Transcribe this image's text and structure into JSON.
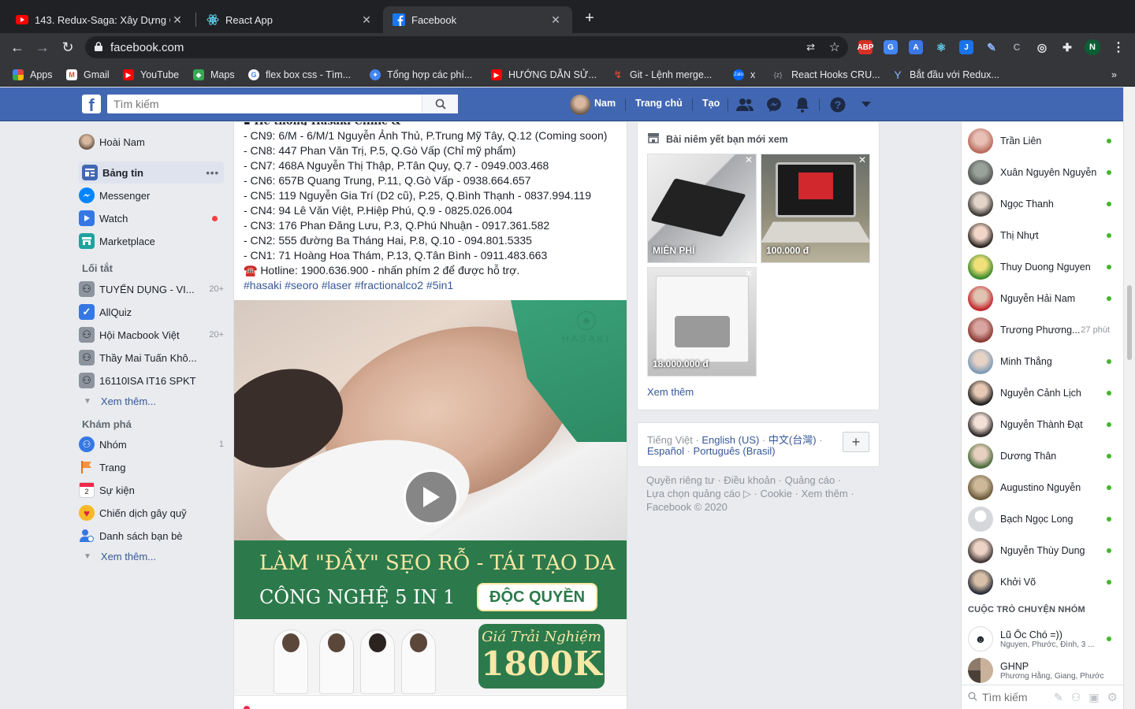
{
  "browser": {
    "tabs": [
      {
        "title": "143. Redux-Saga: Xây Dựng Ch",
        "active": false
      },
      {
        "title": "React App",
        "active": false
      },
      {
        "title": "Facebook",
        "active": true
      }
    ],
    "url": "facebook.com",
    "bookmarks": [
      "Apps",
      "Gmail",
      "YouTube",
      "Maps",
      "flex box css - Tìm...",
      "Tổng hợp các phí...",
      "HƯỚNG DẪN SỬ...",
      "Git - Lệnh merge...",
      "x",
      "React Hooks CRU...",
      "Bắt đầu với Redux..."
    ]
  },
  "topbar": {
    "search_placeholder": "Tìm kiếm",
    "user": "Nam",
    "home": "Trang chủ",
    "create": "Tạo"
  },
  "left": {
    "profile": "Hoài Nam",
    "main": [
      {
        "label": "Bảng tin",
        "icon": "news-feed-icon"
      },
      {
        "label": "Messenger",
        "icon": "messenger-icon"
      },
      {
        "label": "Watch",
        "icon": "watch-icon"
      },
      {
        "label": "Marketplace",
        "icon": "marketplace-icon"
      }
    ],
    "shortcuts_title": "Lối tắt",
    "shortcuts": [
      {
        "label": "TUYỂN DỤNG - VI...",
        "count": "20+"
      },
      {
        "label": "AllQuiz",
        "count": ""
      },
      {
        "label": "Hội Macbook Việt",
        "count": "20+"
      },
      {
        "label": "Thầy Mai Tuấn Khô...",
        "count": ""
      },
      {
        "label": "16110ISA IT16 SPKT",
        "count": ""
      }
    ],
    "see_more": "Xem thêm...",
    "explore_title": "Khám phá",
    "explore": [
      {
        "label": "Nhóm",
        "count": "1"
      },
      {
        "label": "Trang",
        "count": ""
      },
      {
        "label": "Sự kiện",
        "count": ""
      },
      {
        "label": "Chiến dịch gây quỹ",
        "count": ""
      },
      {
        "label": "Danh sách bạn bè",
        "count": ""
      }
    ]
  },
  "post": {
    "lines": [
      "- CN9: 6/M - 6/M/1 Nguyễn Ảnh Thủ, P.Trung Mỹ Tây, Q.12 (Coming soon)",
      "- CN8: 447 Phan Văn Trị, P.5, Q.Gò Vấp (Chỉ mỹ phẩm)",
      "- CN7: 468A Nguyễn Thị Thập, P.Tân Quy, Q.7 - 0949.003.468",
      "- CN6: 657B Quang Trung, P.11, Q.Gò Vấp - 0938.664.657",
      "- CN5: 119 Nguyễn Gia Trí (D2 cũ), P.25, Q.Bình Thạnh - 0837.994.119",
      "- CN4: 94 Lê Văn Việt, P.Hiệp Phú, Q.9 - 0825.026.004",
      "- CN3: 176 Phan Đăng Lưu, P.3, Q.Phú Nhuận - 0917.361.582",
      "- CN2: 555 đường Ba Tháng Hai, P.8, Q.10 - 094.801.5335",
      "- CN1: 71 Hoàng Hoa Thám, P.13, Q.Tân Bình - 0911.483.663",
      "☎️ Hotline: 1900.636.900 - nhấn phím 2 để được hỗ trợ."
    ],
    "hashtags": "#hasaki #seoro #laser #fractionalco2 #5in1",
    "brand": "HASAKI",
    "banner_line1": "LÀM \"ĐẦY\" SẸO RỖ - TÁI TẠO DA",
    "banner_line2": "CÔNG NGHỆ 5 IN 1",
    "banner_badge": "ĐỘC QUYỀN",
    "price_label": "Giá Trải Nghiệm",
    "price_value": "1800K"
  },
  "marketplace": {
    "title": "Bài niêm yết bạn mới xem",
    "items": [
      {
        "price": "MIỄN PHÍ"
      },
      {
        "price": "100.000 đ"
      },
      {
        "price": "18.000.000 đ"
      }
    ],
    "see_more": "Xem thêm"
  },
  "languages": {
    "current": "Tiếng Việt",
    "options": [
      "English (US)",
      "中文(台灣)",
      "Español",
      "Português (Brasil)"
    ]
  },
  "footer": {
    "line1": "Quyền riêng tư · Điều khoản · Quảng cáo ·",
    "line2": "Lựa chọn quảng cáo ▷ · Cookie · Xem thêm ·",
    "line3": "Facebook © 2020"
  },
  "chat": {
    "contacts": [
      {
        "name": "Trần Liên",
        "time": ""
      },
      {
        "name": "Xuân Nguyên Nguyễn",
        "time": ""
      },
      {
        "name": "Ngọc Thanh",
        "time": ""
      },
      {
        "name": "Thị Nhựt",
        "time": ""
      },
      {
        "name": "Thuy Duong Nguyen",
        "time": ""
      },
      {
        "name": "Nguyễn Hải Nam",
        "time": ""
      },
      {
        "name": "Trương Phương...",
        "time": "27 phút"
      },
      {
        "name": "Minh Thắng",
        "time": ""
      },
      {
        "name": "Nguyễn Cảnh Lịch",
        "time": ""
      },
      {
        "name": "Nguyễn Thành Đạt",
        "time": ""
      },
      {
        "name": "Dương Thân",
        "time": ""
      },
      {
        "name": "Augustino Nguyễn",
        "time": ""
      },
      {
        "name": "Bạch Ngọc Long",
        "time": ""
      },
      {
        "name": "Nguyễn Thùy Dung",
        "time": ""
      },
      {
        "name": "Khởi Võ",
        "time": ""
      }
    ],
    "group_title": "CUỘC TRÒ CHUYỆN NHÓM",
    "groups": [
      {
        "name": "Lũ Ốc Chó =))",
        "members": "Nguyen, Phước, Đình, 3 ..."
      },
      {
        "name": "GHNP",
        "members": "Phương Hằng, Giang, Phước"
      }
    ],
    "search_placeholder": "Tìm kiếm"
  },
  "colors": {
    "facebook_blue": "#4267b2",
    "online_green": "#42b72a",
    "link_blue": "#365899"
  }
}
